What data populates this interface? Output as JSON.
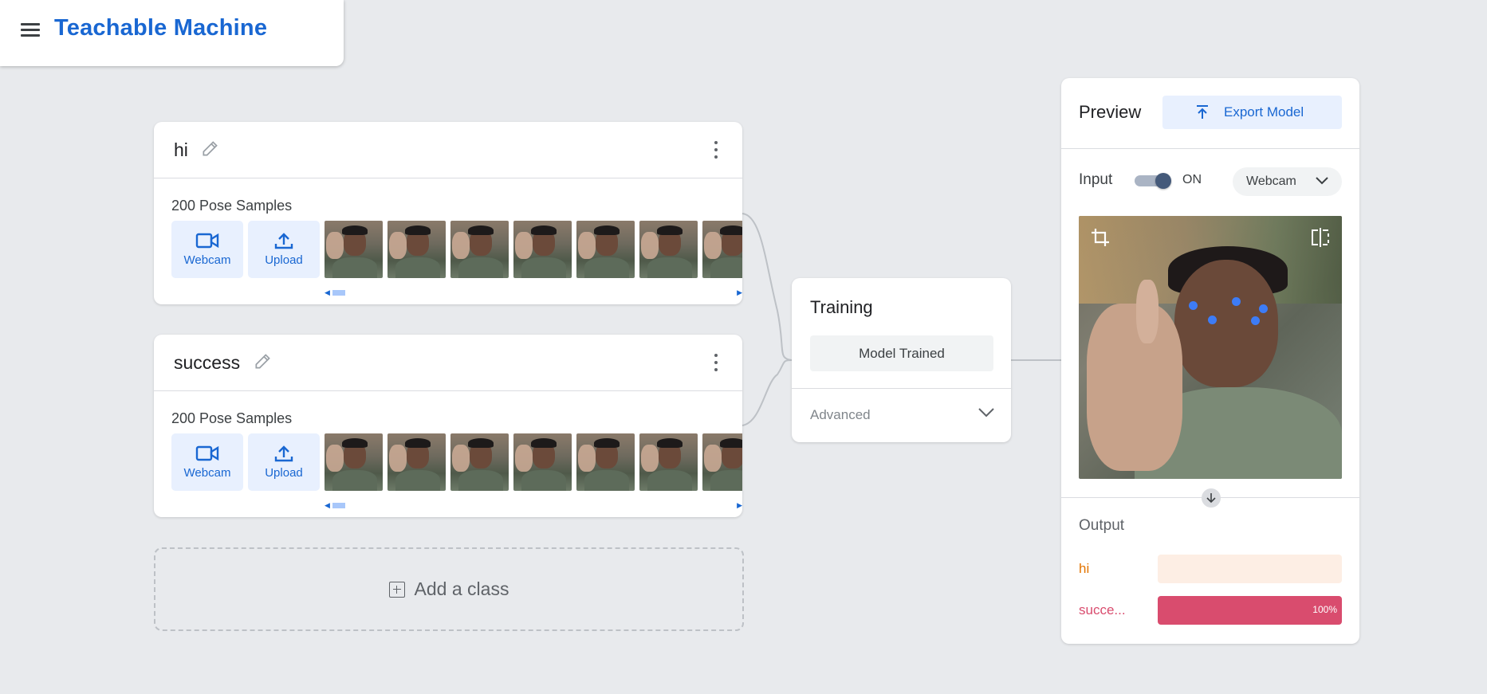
{
  "app": {
    "title": "Teachable Machine"
  },
  "classes": [
    {
      "name": "hi",
      "sample_count": "200 Pose Samples",
      "webcam_label": "Webcam",
      "upload_label": "Upload",
      "thumbnails": 7
    },
    {
      "name": "success",
      "sample_count": "200 Pose Samples",
      "webcam_label": "Webcam",
      "upload_label": "Upload",
      "thumbnails": 7
    }
  ],
  "add_class": {
    "label": "Add a class"
  },
  "training": {
    "title": "Training",
    "status_button": "Model Trained",
    "advanced_label": "Advanced"
  },
  "preview": {
    "title": "Preview",
    "export_label": "Export Model",
    "input_label": "Input",
    "toggle_state": "ON",
    "source_select": "Webcam",
    "output_title": "Output",
    "outputs": [
      {
        "label": "hi",
        "confidence": 0,
        "percent_text": "",
        "color": "#e37400",
        "track_color": "#fdeee4"
      },
      {
        "label": "succe...",
        "confidence": 1.0,
        "percent_text": "100%",
        "color": "#d94c6e",
        "track_color": "#fde7ec"
      }
    ]
  },
  "colors": {
    "brand": "#1967d2",
    "background": "#e8eaed",
    "accent_light": "#e8f0fe"
  }
}
